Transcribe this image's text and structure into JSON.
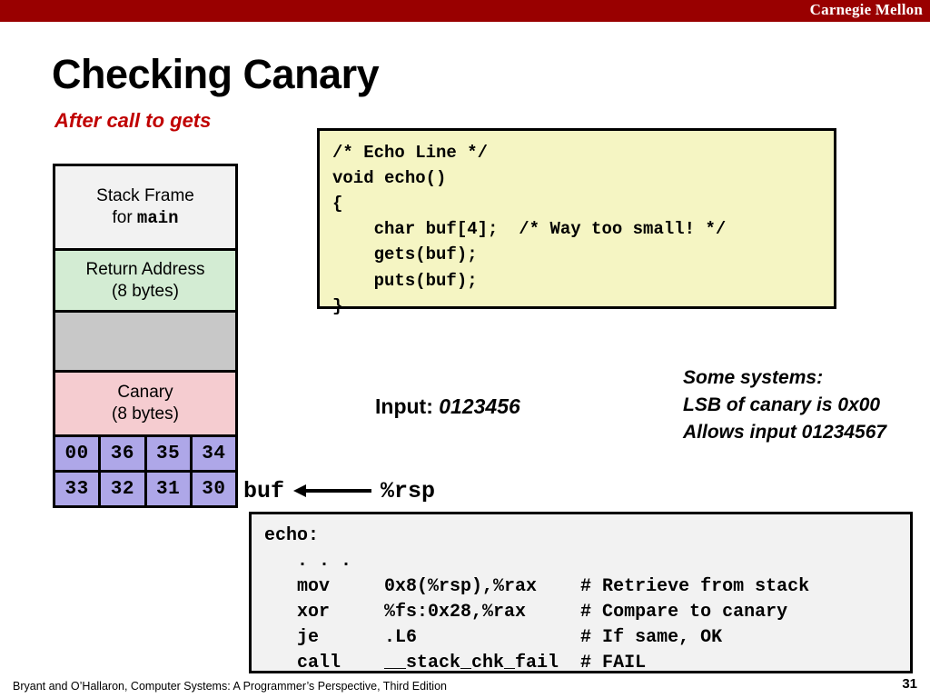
{
  "header": {
    "brand": "Carnegie Mellon"
  },
  "title": {
    "main": "Checking Canary",
    "subtitle": "After call to gets"
  },
  "stack_diagram": {
    "rows": [
      {
        "name": "main-frame",
        "line1": "Stack Frame",
        "line2_prefix": "for ",
        "line2_mono": "main"
      },
      {
        "name": "return-address",
        "line1": "Return Address",
        "line2": "(8 bytes)"
      },
      {
        "name": "gap",
        "line1": "",
        "line2": ""
      },
      {
        "name": "canary",
        "line1": "Canary",
        "line2": "(8 bytes)"
      }
    ],
    "byte_rows": [
      {
        "name": "high-bytes",
        "cells": [
          "00",
          "36",
          "35",
          "34"
        ]
      },
      {
        "name": "low-bytes",
        "cells": [
          "33",
          "32",
          "31",
          "30"
        ]
      }
    ],
    "pointer": {
      "buf_label": "buf",
      "rsp_label": "%rsp"
    }
  },
  "c_code": "/* Echo Line */\nvoid echo()\n{\n    char buf[4];  /* Way too small! */\n    gets(buf);\n    puts(buf);\n}",
  "input": {
    "label": "Input: ",
    "value": "0123456"
  },
  "notes": {
    "line1": "Some systems:",
    "line2": "LSB of canary is 0x00",
    "line3": "Allows input 01234567"
  },
  "asm_code": "echo:\n   . . .\n   mov     0x8(%rsp),%rax    # Retrieve from stack\n   xor     %fs:0x28,%rax     # Compare to canary\n   je      .L6               # If same, OK\n   call    __stack_chk_fail  # FAIL",
  "footer": {
    "citation": "Bryant and O’Hallaron, Computer Systems: A Programmer’s Perspective, Third Edition",
    "page_number": "31"
  },
  "colors": {
    "header_red": "#990000",
    "subtitle_red": "#c00000",
    "code_yellow": "#f5f5c3",
    "asm_gray": "#f2f2f2",
    "main_frame_gray": "#f2f2f2",
    "return_green": "#d3ecd3",
    "gap_gray": "#c8c8c8",
    "canary_pink": "#f5ccd0",
    "byte_purple": "#aea7e8"
  }
}
